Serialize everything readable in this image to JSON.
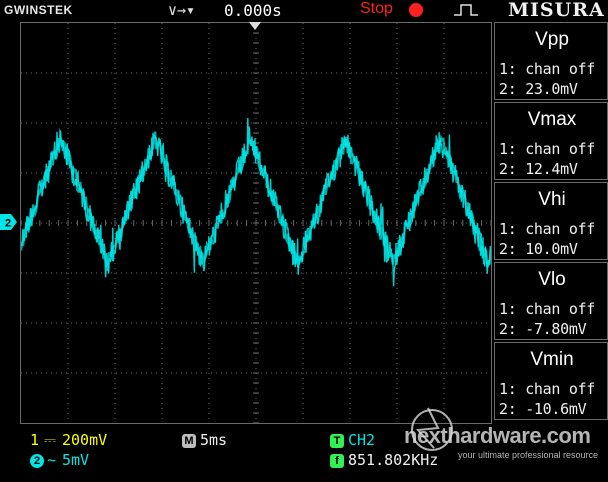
{
  "header": {
    "brand": "GWINSTEK",
    "trigger_position_symbol": "∨→▾",
    "time_offset": "0.000s",
    "run_status": "Stop",
    "overlay_title": "MISURA"
  },
  "measurements": [
    {
      "title": "Vpp",
      "ch1": "1: chan off",
      "ch2": "2: 23.0mV"
    },
    {
      "title": "Vmax",
      "ch1": "1: chan off",
      "ch2": "2: 12.4mV"
    },
    {
      "title": "Vhi",
      "ch1": "1: chan off",
      "ch2": "2: 10.0mV"
    },
    {
      "title": "Vlo",
      "ch1": "1: chan off",
      "ch2": "2: -7.80mV"
    },
    {
      "title": "Vmin",
      "ch1": "1: chan off",
      "ch2": "2: -10.6mV"
    }
  ],
  "footer": {
    "ch1_label": "1",
    "ch1_coupling": "⎓",
    "ch1_scale": "200mV",
    "ch2_label": "2",
    "ch2_coupling": "∼",
    "ch2_scale": "5mV",
    "timebase_badge": "M",
    "timebase": "5ms",
    "trigger_badge": "T",
    "trigger_source": "CH2",
    "freq_badge": "f",
    "frequency": "851.802KHz"
  },
  "channel_marker": "2",
  "watermark": {
    "site": "nexthardware.com",
    "tagline": "your ultimate professional resource"
  },
  "colors": {
    "ch1": "#ffff00",
    "ch2": "#00e5e5",
    "stop": "#ff2020",
    "grid": "#6a6a6a"
  }
}
